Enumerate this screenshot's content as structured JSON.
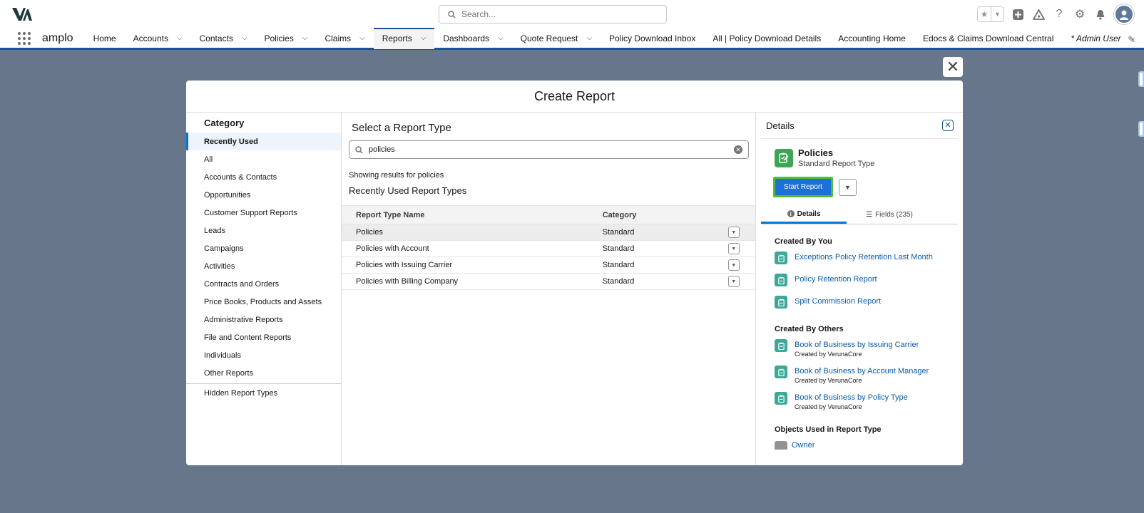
{
  "header": {
    "search_placeholder": "Search...",
    "avatar_icon": "user-avatar-icon"
  },
  "nav": {
    "app_name": "amplo",
    "items": [
      {
        "label": "Home",
        "dropdown": false
      },
      {
        "label": "Accounts",
        "dropdown": true
      },
      {
        "label": "Contacts",
        "dropdown": true
      },
      {
        "label": "Policies",
        "dropdown": true
      },
      {
        "label": "Claims",
        "dropdown": true
      },
      {
        "label": "Reports",
        "dropdown": true
      },
      {
        "label": "Dashboards",
        "dropdown": true
      },
      {
        "label": "Quote Request",
        "dropdown": true
      },
      {
        "label": "Policy Download Inbox",
        "dropdown": false
      },
      {
        "label": "All | Policy Download Details",
        "dropdown": false
      },
      {
        "label": "Accounting Home",
        "dropdown": false
      },
      {
        "label": "Edocs & Claims Download Central",
        "dropdown": false
      }
    ],
    "active_tab": "Reports",
    "temp_tab": "* Admin User"
  },
  "modal": {
    "title": "Create Report",
    "category": {
      "title": "Category",
      "items": [
        "Recently Used",
        "All",
        "Accounts & Contacts",
        "Opportunities",
        "Customer Support Reports",
        "Leads",
        "Campaigns",
        "Activities",
        "Contracts and Orders",
        "Price Books, Products and Assets",
        "Administrative Reports",
        "File and Content Reports",
        "Individuals",
        "Other Reports"
      ],
      "selected": "Recently Used",
      "hidden": "Hidden Report Types"
    },
    "report_types": {
      "title": "Select a Report Type",
      "search_value": "policies",
      "showing": "Showing results for policies",
      "section_title": "Recently Used Report Types",
      "columns": [
        "Report Type Name",
        "Category"
      ],
      "rows": [
        {
          "name": "Policies",
          "category": "Standard",
          "selected": true
        },
        {
          "name": "Policies with Account",
          "category": "Standard",
          "selected": false
        },
        {
          "name": "Policies with Issuing Carrier",
          "category": "Standard",
          "selected": false
        },
        {
          "name": "Policies with Billing Company",
          "category": "Standard",
          "selected": false
        }
      ]
    },
    "details": {
      "title": "Details",
      "report_type_name": "Policies",
      "report_type_kind": "Standard Report Type",
      "start_button": "Start Report",
      "tabs": [
        "Details",
        "Fields (235)"
      ],
      "active_tab": "Details",
      "created_by_you_title": "Created By You",
      "created_by_you": [
        "Exceptions Policy Retention Last Month",
        "Policy Retention Report",
        "Split Commission Report"
      ],
      "created_by_others_title": "Created By Others",
      "created_by_others": [
        {
          "name": "Book of Business by Issuing Carrier",
          "by": "Created by VerunaCore"
        },
        {
          "name": "Book of Business by Account Manager",
          "by": "Created by VerunaCore"
        },
        {
          "name": "Book of Business by Policy Type",
          "by": "Created by VerunaCore"
        }
      ],
      "objects_title": "Objects Used in Report Type",
      "objects": [
        "Owner"
      ]
    }
  },
  "colors": {
    "brand_blue": "#1b5297",
    "button_blue": "#1b72d6",
    "link_blue": "#0b5cab",
    "report_icon_green": "#3ba755",
    "report_item_teal": "#3ca997",
    "highlight_green": "#59b83a",
    "backdrop": "#68768c"
  }
}
